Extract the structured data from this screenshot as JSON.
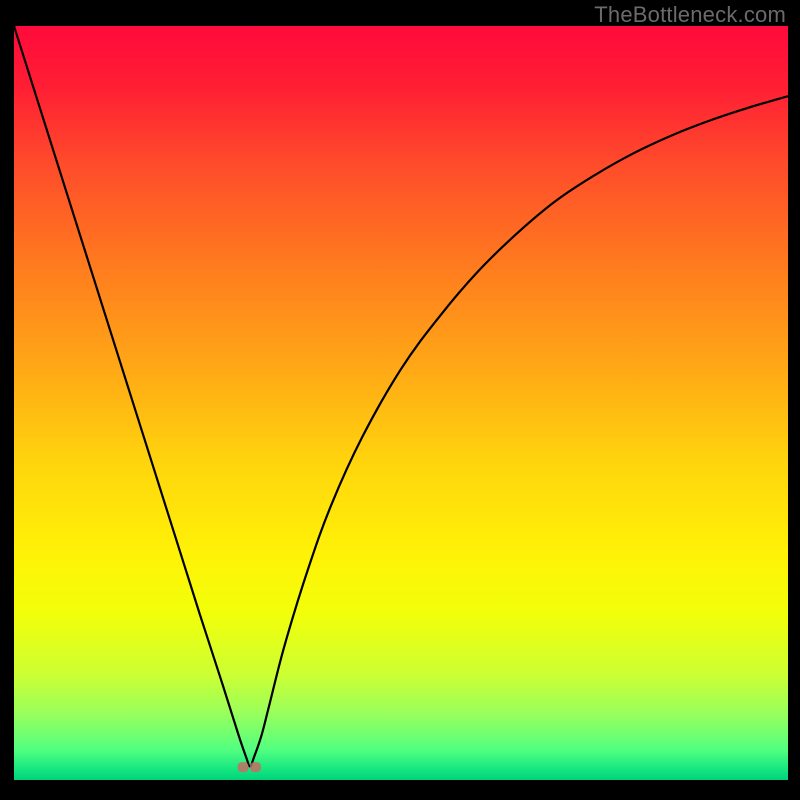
{
  "watermark": "TheBottleneck.com",
  "chart_data": {
    "type": "line",
    "title": "",
    "xlabel": "",
    "ylabel": "",
    "xlim": [
      0,
      100
    ],
    "ylim": [
      0,
      100
    ],
    "grid": false,
    "series": [
      {
        "name": "curve",
        "x": [
          0,
          4,
          8,
          12,
          16,
          20,
          24,
          27,
          29,
          30,
          30.5,
          31,
          32,
          33,
          35,
          38,
          41,
          45,
          50,
          55,
          60,
          65,
          70,
          75,
          80,
          85,
          90,
          95,
          100
        ],
        "values": [
          100,
          87,
          74,
          61,
          48,
          35,
          22,
          12.5,
          6,
          3,
          1.8,
          3,
          6,
          10,
          18,
          28,
          36.5,
          45.5,
          54.5,
          61.5,
          67.5,
          72.5,
          76.8,
          80.2,
          83.1,
          85.5,
          87.5,
          89.2,
          90.7
        ]
      }
    ],
    "annotations": [
      {
        "name": "min-marker-left",
        "x": 29.6,
        "y": 1.7
      },
      {
        "name": "min-marker-right",
        "x": 31.2,
        "y": 1.7
      }
    ],
    "background_gradient": {
      "direction": "vertical",
      "stops": [
        {
          "p": 0,
          "color": "#ff0a3c"
        },
        {
          "p": 45,
          "color": "#ffa716"
        },
        {
          "p": 78,
          "color": "#f2ff0a"
        },
        {
          "p": 100,
          "color": "#00d27a"
        }
      ]
    }
  }
}
